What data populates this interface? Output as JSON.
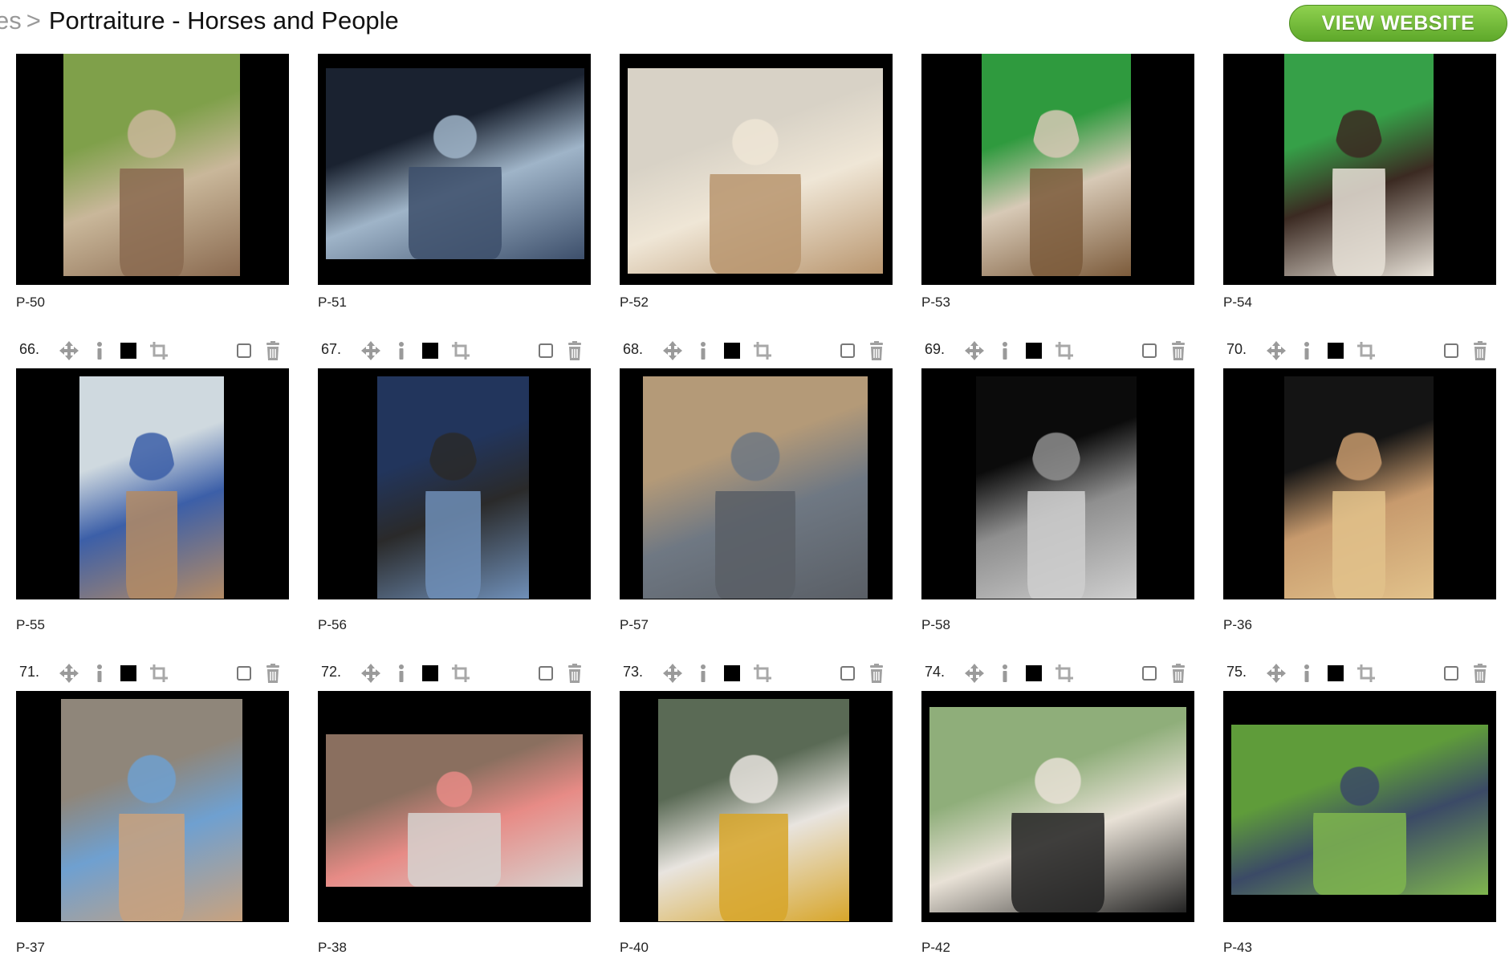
{
  "header": {
    "breadcrumb_prev": "es",
    "breadcrumb_sep": ">",
    "title": "Portraiture - Horses and People",
    "view_button": "VIEW WEBSITE",
    "accent": "#6cb833"
  },
  "icons": {
    "move": "move-arrows-icon",
    "info": "info-icon",
    "color": "black-square-icon",
    "crop": "crop-icon",
    "select": "checkbox",
    "delete": "trash-icon"
  },
  "rows": [
    {
      "items": [
        {
          "caption": "P-50",
          "number": null
        },
        {
          "caption": "P-51",
          "number": null
        },
        {
          "caption": "P-52",
          "number": null
        },
        {
          "caption": "P-53",
          "number": null
        },
        {
          "caption": "P-54",
          "number": null
        }
      ]
    },
    {
      "items": [
        {
          "caption": "P-55",
          "number": "66."
        },
        {
          "caption": "P-56",
          "number": "67."
        },
        {
          "caption": "P-57",
          "number": "68."
        },
        {
          "caption": "P-58",
          "number": "69."
        },
        {
          "caption": "P-36",
          "number": "70."
        }
      ]
    },
    {
      "items": [
        {
          "caption": "P-37",
          "number": "71."
        },
        {
          "caption": "P-38",
          "number": "72."
        },
        {
          "caption": "P-40",
          "number": "73."
        },
        {
          "caption": "P-42",
          "number": "74."
        },
        {
          "caption": "P-43",
          "number": "75."
        }
      ]
    }
  ],
  "photo_palette": [
    [
      "#7fa04a",
      "#c9b79a",
      "#8a6a50"
    ],
    [
      "#1a2230",
      "#9fb4c8",
      "#3d4f6b"
    ],
    [
      "#d8d2c6",
      "#efe6d6",
      "#b9966f"
    ],
    [
      "#2f9a3e",
      "#d7c9b6",
      "#7c5b3b"
    ],
    [
      "#36a048",
      "#3b2a22",
      "#e8e2d8"
    ],
    [
      "#cfd9df",
      "#3c5fa8",
      "#b38b65"
    ],
    [
      "#22355c",
      "#2a2a2a",
      "#6f8fb8"
    ],
    [
      "#b49a78",
      "#6f7883",
      "#5a5f66"
    ],
    [
      "#0b0b0b",
      "#8f8f8f",
      "#cfcfcf"
    ],
    [
      "#141414",
      "#c79a6d",
      "#e2c28b"
    ],
    [
      "#8f867a",
      "#6fa0d0",
      "#c9a27e"
    ],
    [
      "#8a6f5f",
      "#e78b86",
      "#d7d2cf"
    ],
    [
      "#5a6a55",
      "#e8e4df",
      "#d8a62a"
    ],
    [
      "#8fae7a",
      "#e8e1d6",
      "#222222"
    ],
    [
      "#5f9c3a",
      "#3b4a66",
      "#7fb64e"
    ]
  ]
}
